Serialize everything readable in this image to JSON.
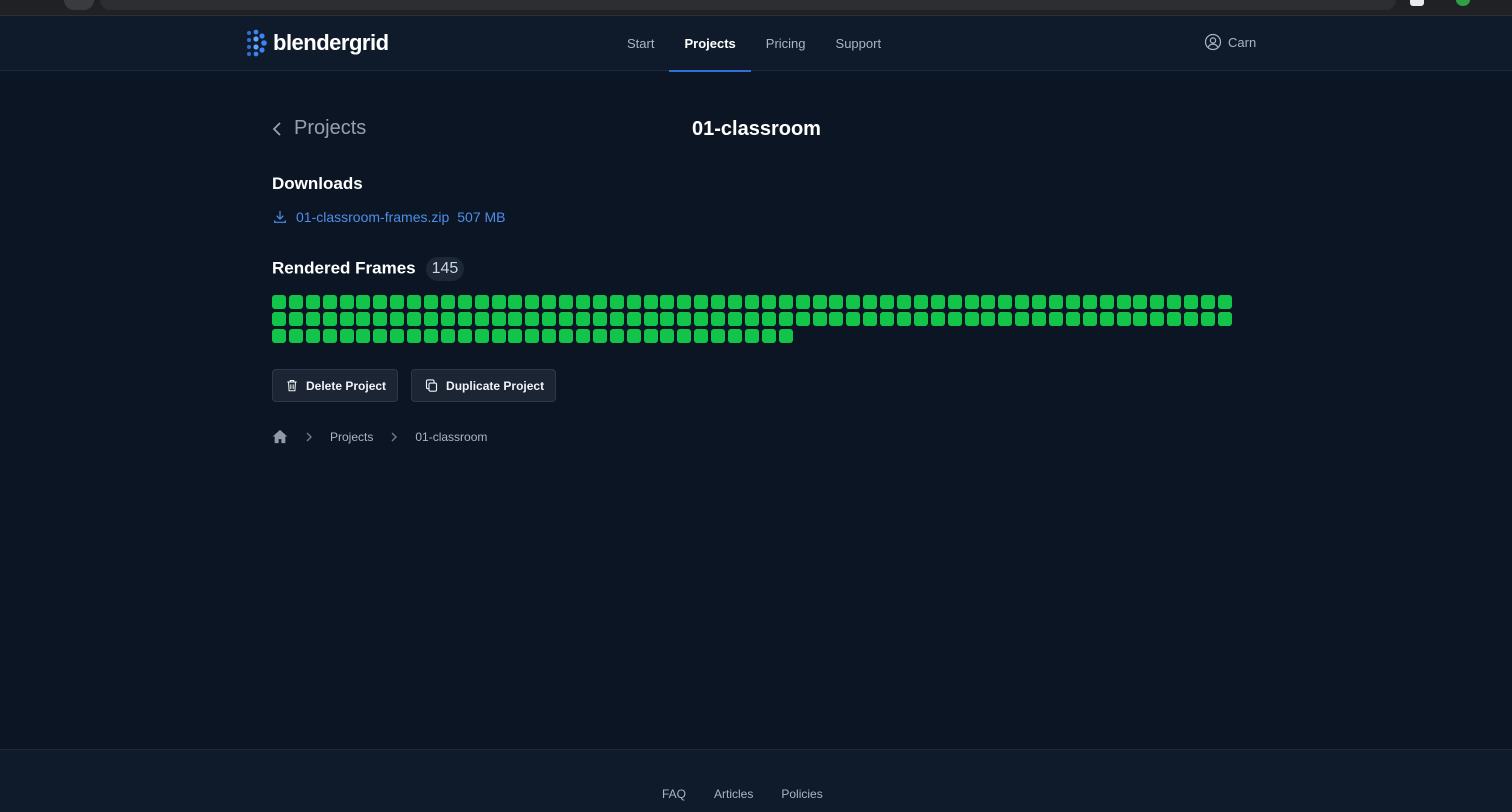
{
  "brand": {
    "name": "blendergrid",
    "accent": "#2f6fd6"
  },
  "nav": {
    "items": [
      {
        "label": "Start",
        "active": false
      },
      {
        "label": "Projects",
        "active": true
      },
      {
        "label": "Pricing",
        "active": false
      },
      {
        "label": "Support",
        "active": false
      }
    ]
  },
  "user": {
    "name": "Carn",
    "icon": "user-circle-icon"
  },
  "page": {
    "back_label": "Projects",
    "title": "01-classroom"
  },
  "downloads": {
    "heading": "Downloads",
    "file_name": "01-classroom-frames.zip",
    "file_size": "507 MB",
    "icon": "download-icon"
  },
  "frames": {
    "heading": "Rendered Frames",
    "count": "145",
    "color": "#12c54a"
  },
  "actions": {
    "delete_label": "Delete Project",
    "duplicate_label": "Duplicate Project"
  },
  "breadcrumb": {
    "home_icon": "home-icon",
    "items": [
      "Projects",
      "01-classroom"
    ]
  },
  "footer": {
    "links": [
      "FAQ",
      "Articles",
      "Policies"
    ]
  }
}
